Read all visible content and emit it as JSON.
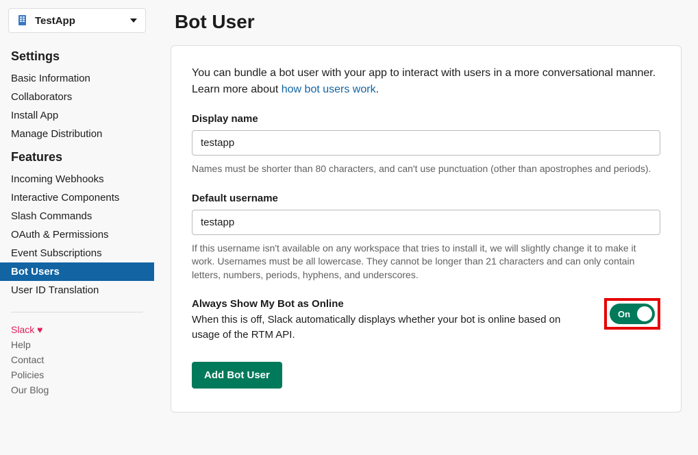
{
  "app_selector": {
    "name": "TestApp"
  },
  "sidebar": {
    "sections": [
      {
        "header": "Settings",
        "items": [
          {
            "label": "Basic Information",
            "active": false
          },
          {
            "label": "Collaborators",
            "active": false
          },
          {
            "label": "Install App",
            "active": false
          },
          {
            "label": "Manage Distribution",
            "active": false
          }
        ]
      },
      {
        "header": "Features",
        "items": [
          {
            "label": "Incoming Webhooks",
            "active": false
          },
          {
            "label": "Interactive Components",
            "active": false
          },
          {
            "label": "Slash Commands",
            "active": false
          },
          {
            "label": "OAuth & Permissions",
            "active": false
          },
          {
            "label": "Event Subscriptions",
            "active": false
          },
          {
            "label": "Bot Users",
            "active": true
          },
          {
            "label": "User ID Translation",
            "active": false
          }
        ]
      }
    ],
    "footer": [
      {
        "label": "Slack",
        "heart": true
      },
      {
        "label": "Help"
      },
      {
        "label": "Contact"
      },
      {
        "label": "Policies"
      },
      {
        "label": "Our Blog"
      }
    ]
  },
  "page": {
    "title": "Bot User",
    "intro_before": "You can bundle a bot user with your app to interact with users in a more conversational manner. Learn more about ",
    "intro_link": "how bot users work",
    "intro_after": ".",
    "display_name": {
      "label": "Display name",
      "value": "testapp",
      "helper": "Names must be shorter than 80 characters, and can't use punctuation (other than apostrophes and periods)."
    },
    "default_username": {
      "label": "Default username",
      "value": "testapp",
      "helper": "If this username isn't available on any workspace that tries to install it, we will slightly change it to make it work. Usernames must be all lowercase. They cannot be longer than 21 characters and can only contain letters, numbers, periods, hyphens, and underscores."
    },
    "always_online": {
      "title": "Always Show My Bot as Online",
      "desc": "When this is off, Slack automatically displays whether your bot is online based on usage of the RTM API.",
      "toggle_label": "On"
    },
    "submit_label": "Add Bot User"
  }
}
